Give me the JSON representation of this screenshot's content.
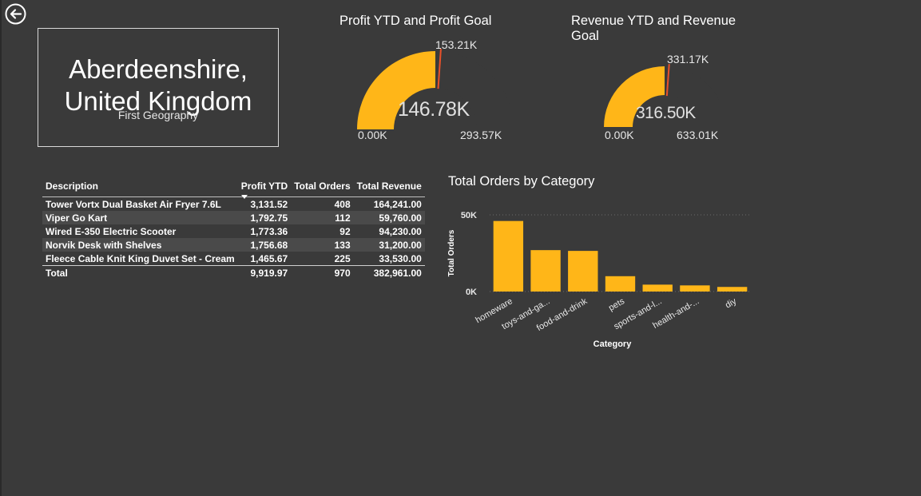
{
  "nav": {
    "back_icon": "back-arrow-icon"
  },
  "card": {
    "name": "Aberdeenshire, United Kingdom",
    "label": "First Geography"
  },
  "gauges": [
    {
      "title": "Profit YTD and Profit Goal",
      "value": "146.78K",
      "min": "0.00K",
      "max": "293.57K",
      "target": "153.21K",
      "value_num": 146.78,
      "min_num": 0,
      "max_num": 293.57,
      "target_num": 153.21
    },
    {
      "title": "Revenue YTD and Revenue Goal",
      "value": "316.50K",
      "min": "0.00K",
      "max": "633.01K",
      "target": "331.17K",
      "value_num": 316.5,
      "min_num": 0,
      "max_num": 633.01,
      "target_num": 331.17
    }
  ],
  "table": {
    "headers": [
      "Description",
      "Profit YTD",
      "Total Orders",
      "Total Revenue"
    ],
    "rows": [
      [
        "Tower Vortx Dual Basket Air Fryer 7.6L",
        "3,131.52",
        "408",
        "164,241.00"
      ],
      [
        "Viper Go Kart",
        "1,792.75",
        "112",
        "59,760.00"
      ],
      [
        "Wired E-350 Electric Scooter",
        "1,773.36",
        "92",
        "94,230.00"
      ],
      [
        "Norvik Desk with Shelves",
        "1,756.68",
        "133",
        "31,200.00"
      ],
      [
        "Fleece Cable Knit King Duvet Set - Cream",
        "1,465.67",
        "225",
        "33,530.00"
      ]
    ],
    "total": [
      "Total",
      "9,919.97",
      "970",
      "382,961.00"
    ]
  },
  "chart_data": {
    "type": "bar",
    "title": "Total Orders by Category",
    "xlabel": "Category",
    "ylabel": "Total Orders",
    "categories": [
      "homeware",
      "toys-and-ga...",
      "food-and-drink",
      "pets",
      "sports-and-l...",
      "health-and-...",
      "diy"
    ],
    "values": [
      46000,
      27000,
      26500,
      10000,
      4500,
      4000,
      3000
    ],
    "ylim": [
      0,
      50000
    ],
    "yticks": [
      "0K",
      "50K"
    ],
    "color": "#ffb618"
  },
  "colors": {
    "accent": "#ffb618",
    "target": "#e8512a",
    "gauge_track": "#3a3a3a"
  }
}
